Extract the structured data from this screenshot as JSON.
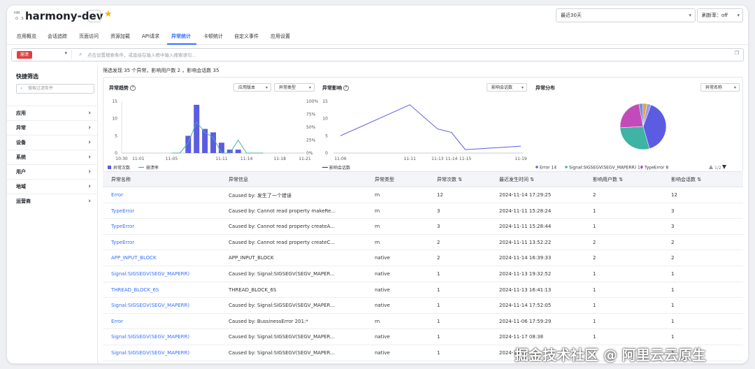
{
  "header": {
    "logo_chars": [
      "HM",
      "",
      "O",
      "S"
    ],
    "app_title": "harmony-dev",
    "app_caret": "▾",
    "star": "★",
    "time_range": "最近30天",
    "refresh": "刷新率：off"
  },
  "tabs": [
    {
      "label": "应用概览"
    },
    {
      "label": "会话追踪"
    },
    {
      "label": "页面访问"
    },
    {
      "label": "资源加载"
    },
    {
      "label": "API请求"
    },
    {
      "label": "异常统计",
      "active": true
    },
    {
      "label": "卡顿统计"
    },
    {
      "label": "自定义事件"
    },
    {
      "label": "应用设置"
    }
  ],
  "search": {
    "tag": "崩溃",
    "placeholder": "点击设置搜索条件，或直接在输入框中输入搜索语句..."
  },
  "sidebar": {
    "title": "快捷筛选",
    "filter_placeholder": "搜索过滤条件",
    "items": [
      {
        "label": "应用"
      },
      {
        "label": "异常"
      },
      {
        "label": "设备"
      },
      {
        "label": "系统"
      },
      {
        "label": "用户"
      },
      {
        "label": "地域"
      },
      {
        "label": "运营商"
      }
    ]
  },
  "summary": "筛选发现 35 个异常，影响用户数 2 ，影响会话数 35",
  "charts": {
    "trend": {
      "title": "异常趋势",
      "sel1": "应用版本",
      "sel2": "异常类型",
      "legend1": "异常次数",
      "legend2": "崩溃率"
    },
    "impact": {
      "title": "异常影响",
      "sel1": "影响会话数",
      "legend1": "影响会话数"
    },
    "dist": {
      "title": "异常分布",
      "sel1": "异常名称",
      "legend": [
        "Error 14",
        "Signal:SIGSEGV(SEGV_MAPERR) 10",
        "TypeError 8"
      ],
      "pager": "1/2"
    }
  },
  "chart_data": [
    {
      "type": "bar",
      "title": "异常趋势",
      "x_ticks": [
        "10-30",
        "11-01",
        "11-05",
        "11-11",
        "11-14",
        "11-18",
        "11-21"
      ],
      "y_ticks": [
        0,
        5,
        10,
        15
      ],
      "y2_ticks": [
        "0%",
        "25%",
        "50%",
        "75%",
        "100%"
      ],
      "series": [
        {
          "name": "异常次数",
          "kind": "bar",
          "x": [
            "11-07",
            "11-08",
            "11-09",
            "11-10",
            "11-11",
            "11-12",
            "11-13"
          ],
          "values": [
            5,
            14,
            7,
            6,
            3,
            1,
            1
          ]
        },
        {
          "name": "崩溃率",
          "kind": "line",
          "x": [
            "11-05",
            "11-06",
            "11-07",
            "11-08",
            "11-09",
            "11-10",
            "11-11",
            "11-12",
            "11-13",
            "11-14",
            "11-15",
            "11-16"
          ],
          "values": [
            0,
            0,
            20,
            60,
            40,
            30,
            0,
            0,
            25,
            0,
            0,
            0
          ]
        }
      ],
      "ylim": [
        0,
        15
      ]
    },
    {
      "type": "line",
      "title": "异常影响",
      "x_ticks": [
        "11-06",
        "11-11",
        "11-13",
        "11-14",
        "11-15",
        "11-19"
      ],
      "y_ticks": [
        0,
        5,
        10,
        15
      ],
      "series": [
        {
          "name": "影响会话数",
          "x": [
            "11-06",
            "11-11",
            "11-13",
            "11-14",
            "11-15",
            "11-19"
          ],
          "values": [
            5,
            14,
            7,
            6,
            1,
            2
          ]
        }
      ],
      "ylim": [
        0,
        15
      ]
    },
    {
      "type": "pie",
      "title": "异常分布",
      "slices": [
        {
          "label": "Error",
          "value": 14,
          "color": "#5b5ce2"
        },
        {
          "label": "Signal:SIGSEGV(SEGV_MAPERR)",
          "value": 10,
          "color": "#3fb3a4"
        },
        {
          "label": "TypeError",
          "value": 8,
          "color": "#c34bb9"
        },
        {
          "label": "",
          "value": 1,
          "color": "#7b8fd0"
        },
        {
          "label": "",
          "value": 1,
          "color": "#e9a23b"
        },
        {
          "label": "",
          "value": 1,
          "color": "#9a9cf0"
        }
      ]
    }
  ],
  "table": {
    "headers": [
      "异常名称",
      "异常信息",
      "异常类型",
      "异常次数 ⇅",
      "最近发生时间 ⇅",
      "影响用户数 ⇅",
      "影响会话数 ⇅"
    ],
    "rows": [
      [
        "Error",
        "Caused by: 发生了一个错误",
        "rn",
        "12",
        "2024-11-14 17:29:25",
        "2",
        "12"
      ],
      [
        "TypeError",
        "Caused by: Cannot read property makeRe...",
        "rn",
        "3",
        "2024-11-11 15:28:24",
        "1",
        "3"
      ],
      [
        "TypeError",
        "Caused by: Cannot read property createA...",
        "rn",
        "3",
        "2024-11-11 15:28:44",
        "1",
        "3"
      ],
      [
        "TypeError",
        "Caused by: Cannot read property createC...",
        "rn",
        "2",
        "2024-11-11 13:52:22",
        "2",
        "2"
      ],
      [
        "APP_INPUT_BLOCK",
        "APP_INPUT_BLOCK",
        "native",
        "2",
        "2024-11-14 16:39:33",
        "2",
        "2"
      ],
      [
        "Signal:SIGSEGV(SEGV_MAPERR)",
        "Caused by: Signal:SIGSEGV(SEGV_MAPER...",
        "native",
        "1",
        "2024-11-13 19:32:52",
        "1",
        "1"
      ],
      [
        "THREAD_BLOCK_6S",
        "THREAD_BLOCK_6S",
        "native",
        "1",
        "2024-11-13 16:41:13",
        "1",
        "1"
      ],
      [
        "Signal:SIGSEGV(SEGV_MAPERR)",
        "Caused by: Signal:SIGSEGV(SEGV_MAPER...",
        "native",
        "1",
        "2024-11-14 17:52:05",
        "1",
        "1"
      ],
      [
        "Error",
        "Caused by: BussinessError 201:*",
        "rn",
        "1",
        "2024-11-06 17:59:29",
        "1",
        "1"
      ],
      [
        "Signal:SIGSEGV(SEGV_MAPERR)",
        "Caused by: Signal:SIGSEGV(SEGV_MAPER...",
        "native",
        "1",
        "2024-11-17 08:38",
        "1",
        "1"
      ],
      [
        "Signal:SIGSEGV(SEGV_MAPERR)",
        "Caused by: Signal:SIGSEGV(SEGV_MAPER...",
        "native",
        "1",
        "2024-11-1",
        "1",
        "1"
      ]
    ]
  },
  "watermark": "掘金技术社区 @ 阿里云云原生"
}
